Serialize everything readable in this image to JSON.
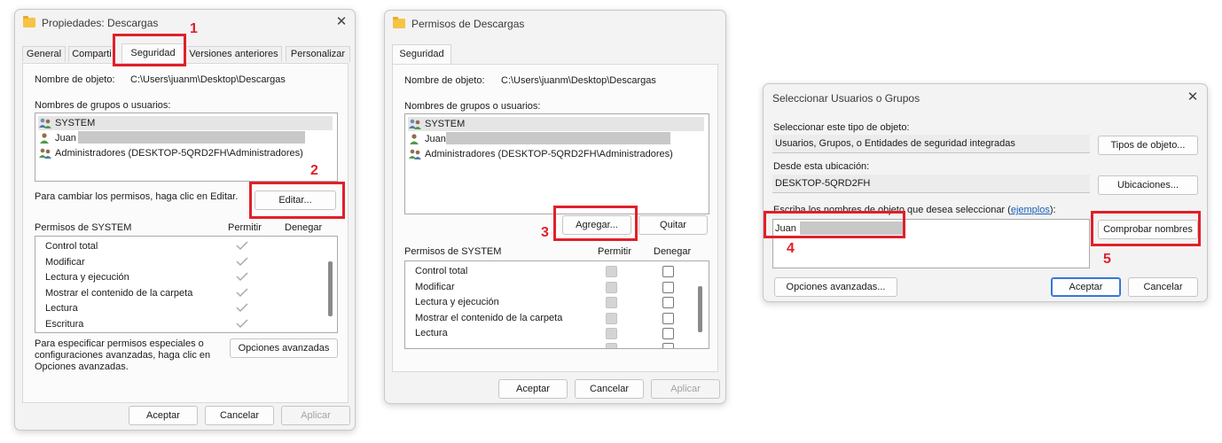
{
  "dlg1": {
    "title": "Propiedades: Descargas",
    "tabs": [
      "General",
      "Comparti",
      "Seguridad",
      "Versiones anteriores",
      "Personalizar"
    ],
    "object_label": "Nombre de objeto:",
    "object_value": "C:\\Users\\juanm\\Desktop\\Descargas",
    "groups_label": "Nombres de grupos o usuarios:",
    "users": [
      "SYSTEM",
      "Juan",
      "Administradores (DESKTOP-5QRD2FH\\Administradores)"
    ],
    "change_text": "Para cambiar los permisos, haga clic en Editar.",
    "edit_button": "Editar...",
    "perms_label": "Permisos de SYSTEM",
    "allow_label": "Permitir",
    "deny_label": "Denegar",
    "permissions": [
      "Control total",
      "Modificar",
      "Lectura y ejecución",
      "Mostrar el contenido de la carpeta",
      "Lectura",
      "Escritura"
    ],
    "special_text": [
      "Para especificar permisos especiales o",
      "configuraciones avanzadas, haga clic en",
      "Opciones avanzadas."
    ],
    "advanced_button": "Opciones avanzadas",
    "ok": "Aceptar",
    "cancel": "Cancelar",
    "apply": "Aplicar"
  },
  "dlg2": {
    "title": "Permisos de Descargas",
    "tab": "Seguridad",
    "object_label": "Nombre de objeto:",
    "object_value": "C:\\Users\\juanm\\Desktop\\Descargas",
    "groups_label": "Nombres de grupos o usuarios:",
    "users": [
      "SYSTEM",
      "Juan",
      "Administradores (DESKTOP-5QRD2FH\\Administradores)"
    ],
    "add_button": "Agregar...",
    "remove_button": "Quitar",
    "perms_label": "Permisos de SYSTEM",
    "allow_label": "Permitir",
    "deny_label": "Denegar",
    "permissions": [
      "Control total",
      "Modificar",
      "Lectura y ejecución",
      "Mostrar el contenido de la carpeta",
      "Lectura"
    ],
    "ok": "Aceptar",
    "cancel": "Cancelar",
    "apply": "Aplicar"
  },
  "dlg3": {
    "title": "Seleccionar Usuarios o Grupos",
    "type_label": "Seleccionar este tipo de objeto:",
    "type_value": "Usuarios, Grupos, o Entidades de seguridad integradas",
    "types_button": "Tipos de objeto...",
    "location_label": "Desde esta ubicación:",
    "location_value": "DESKTOP-5QRD2FH",
    "locations_button": "Ubicaciones...",
    "names_label": "Escriba los nombres de objeto que desea seleccionar (",
    "names_link": "ejemplos",
    "names_label_end": "):",
    "names_value": "Juan",
    "check_button": "Comprobar nombres",
    "advanced_button": "Opciones avanzadas...",
    "ok": "Aceptar",
    "cancel": "Cancelar"
  },
  "callouts": [
    "1",
    "2",
    "3",
    "4",
    "5"
  ],
  "colors": {
    "callout": "#e0202a",
    "primary_border": "#2d6fd0",
    "link": "#1a5fb4"
  }
}
